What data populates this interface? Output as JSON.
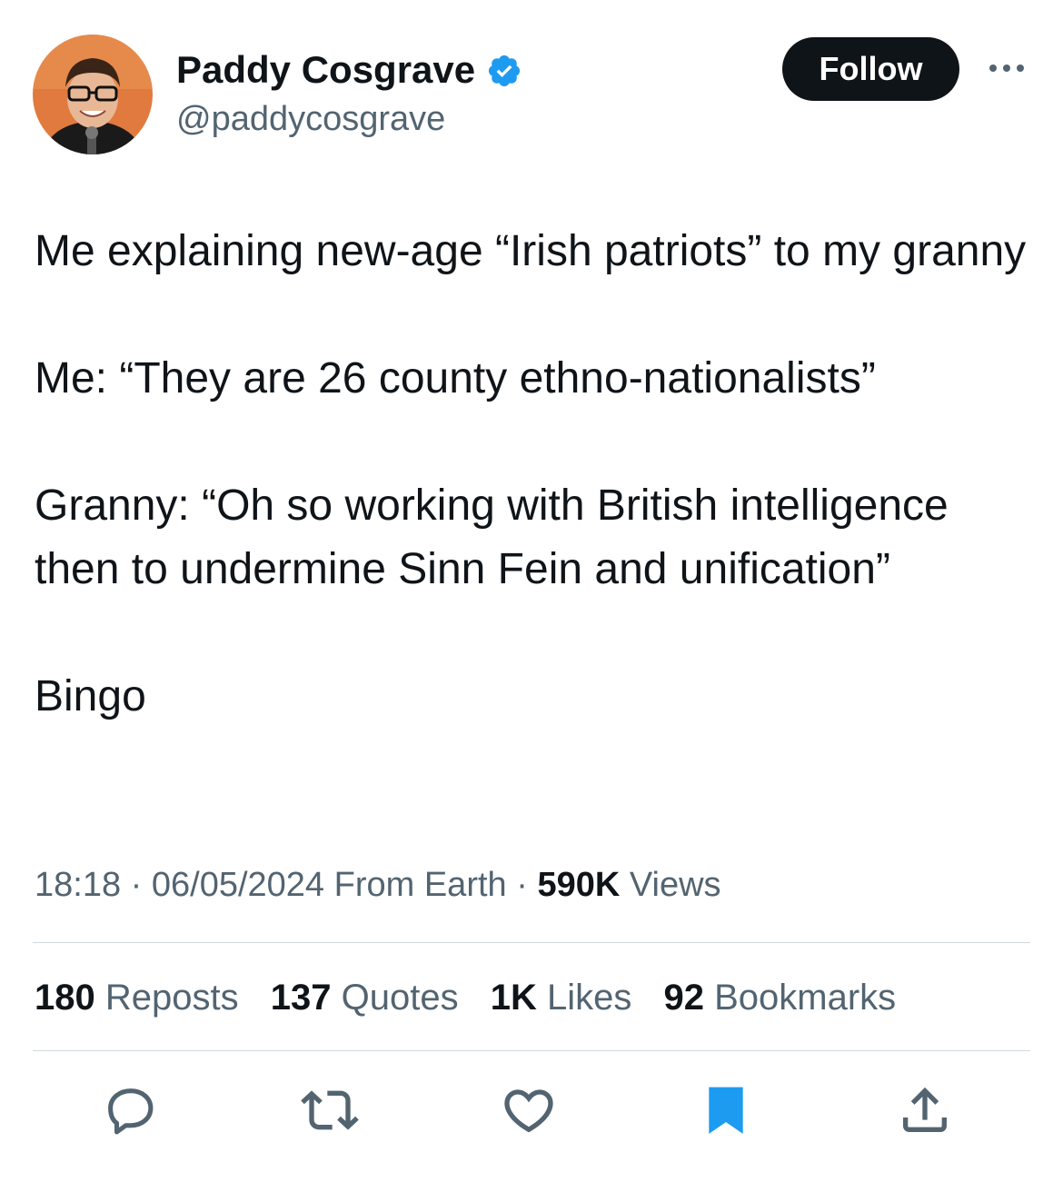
{
  "author": {
    "display_name": "Paddy Cosgrave",
    "handle": "@paddycosgrave",
    "verified_icon": "verified-badge-icon"
  },
  "header": {
    "follow_label": "Follow",
    "more_icon": "more-dots-icon"
  },
  "tweet": {
    "line1": "Me explaining new-age “Irish patriots” to my granny",
    "line2": "Me: “They are 26 county ethno-nationalists”",
    "line3": "Granny: “Oh so working with British intelligence then to undermine Sinn Fein and unification”",
    "line4": "Bingo"
  },
  "meta": {
    "time": "18:18",
    "date": "06/05/2024",
    "source": "From Earth",
    "separator": "·",
    "views_count": "590K",
    "views_label": "Views"
  },
  "stats": {
    "reposts_count": "180",
    "reposts_label": "Reposts",
    "quotes_count": "137",
    "quotes_label": "Quotes",
    "likes_count": "1K",
    "likes_label": "Likes",
    "bookmarks_count": "92",
    "bookmarks_label": "Bookmarks"
  },
  "actions": {
    "reply_icon": "reply-icon",
    "repost_icon": "repost-icon",
    "like_icon": "heart-icon",
    "bookmark_icon": "bookmark-icon",
    "share_icon": "share-icon"
  },
  "colors": {
    "text": "#0f1419",
    "secondary": "#536471",
    "accent": "#1d9bf0",
    "divider": "#cfd9de"
  }
}
